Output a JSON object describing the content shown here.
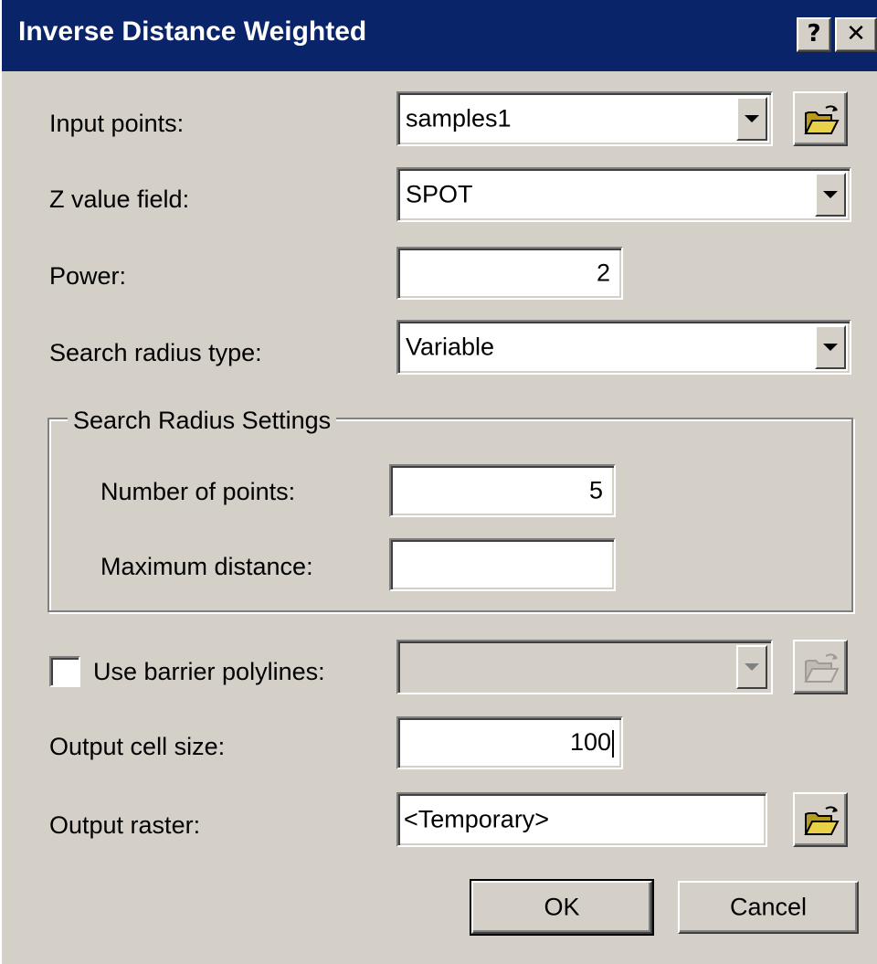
{
  "window": {
    "title": "Inverse Distance Weighted",
    "help_label": "?",
    "close_label": "✕"
  },
  "form": {
    "input_points": {
      "label": "Input points:",
      "value": "samples1"
    },
    "z_value_field": {
      "label": "Z value field:",
      "value": "SPOT"
    },
    "power": {
      "label": "Power:",
      "value": "2"
    },
    "search_radius_type": {
      "label": "Search radius type:",
      "value": "Variable"
    },
    "search_radius_settings": {
      "legend": "Search Radius Settings",
      "number_of_points": {
        "label": "Number of points:",
        "value": "5"
      },
      "maximum_distance": {
        "label": "Maximum distance:",
        "value": ""
      }
    },
    "use_barrier_polylines": {
      "label": "Use barrier polylines:",
      "checked": false,
      "value": ""
    },
    "output_cell_size": {
      "label": "Output cell size:",
      "value": "100"
    },
    "output_raster": {
      "label": "Output raster:",
      "value": "<Temporary>"
    }
  },
  "buttons": {
    "ok_label": "OK",
    "cancel_label": "Cancel"
  },
  "icons": {
    "browse": "open-folder-icon",
    "dropdown": "chevron-down-icon",
    "help": "help-icon",
    "close": "close-icon"
  },
  "colors": {
    "titlebar": "#0a246a",
    "face": "#d4d0c8",
    "folder": "#e8d048"
  }
}
